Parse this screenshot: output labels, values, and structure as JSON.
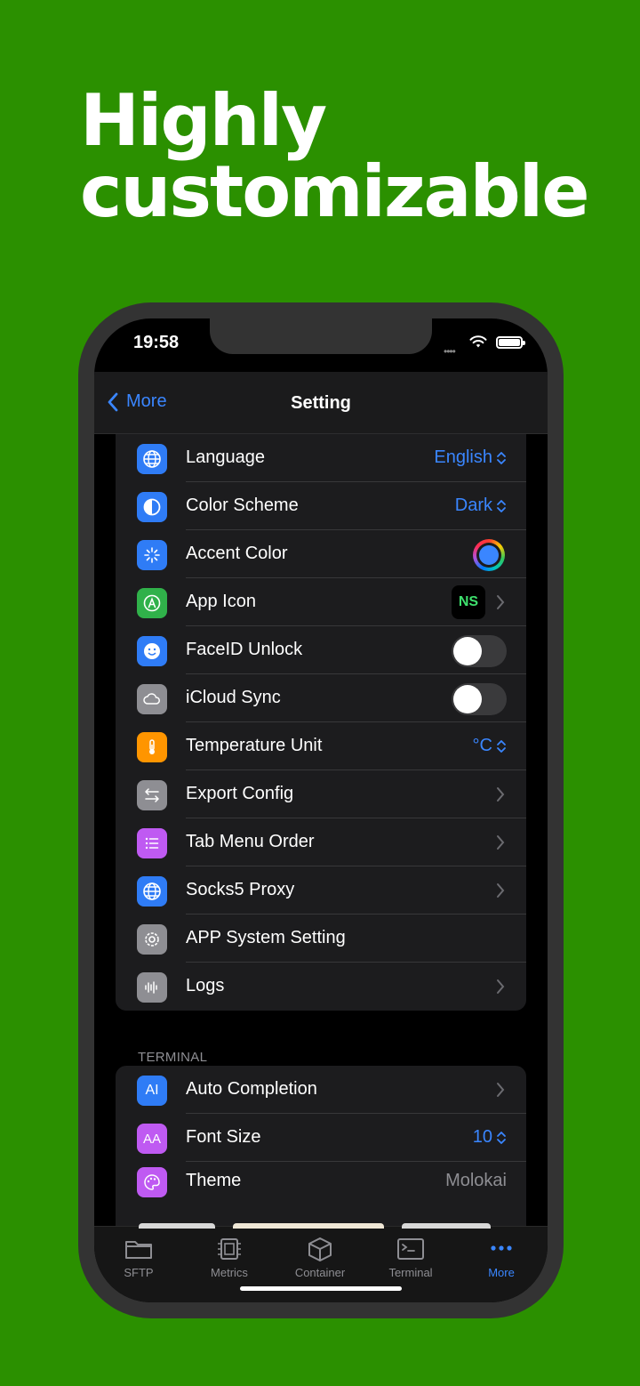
{
  "headline": {
    "line1": "Highly",
    "line2": "customizable"
  },
  "status": {
    "time": "19:58",
    "signal": "••••"
  },
  "nav": {
    "back_label": "More",
    "title": "Setting"
  },
  "settings": {
    "language": {
      "label": "Language",
      "value": "English",
      "icon": "globe-icon",
      "color": "#2f7cf6"
    },
    "color_scheme": {
      "label": "Color Scheme",
      "value": "Dark",
      "icon": "half-circle-icon",
      "color": "#2f7cf6"
    },
    "accent_color": {
      "label": "Accent Color",
      "icon": "sparkle-icon",
      "color": "#2f7cf6",
      "accent": "#3a86ff"
    },
    "app_icon": {
      "label": "App Icon",
      "icon": "app-store-icon",
      "color": "#30b14a",
      "preview": "NS"
    },
    "faceid": {
      "label": "FaceID Unlock",
      "icon": "face-icon",
      "color": "#2f7cf6",
      "on": false
    },
    "icloud": {
      "label": "iCloud Sync",
      "icon": "cloud-icon",
      "color": "#8e8e93",
      "on": false
    },
    "temperature": {
      "label": "Temperature Unit",
      "value": "°C",
      "icon": "thermometer-icon",
      "color": "#ff9500"
    },
    "export": {
      "label": "Export Config",
      "icon": "arrows-icon",
      "color": "#8e8e93"
    },
    "tab_order": {
      "label": "Tab Menu Order",
      "icon": "list-icon",
      "color": "#bf5af2"
    },
    "socks5": {
      "label": "Socks5 Proxy",
      "icon": "globe-icon",
      "color": "#2f7cf6"
    },
    "system": {
      "label": "APP System Setting",
      "icon": "gear-icon",
      "color": "#8e8e93"
    },
    "logs": {
      "label": "Logs",
      "icon": "waveform-icon",
      "color": "#8e8e93"
    }
  },
  "terminal": {
    "header": "TERMINAL",
    "auto_completion": {
      "label": "Auto Completion",
      "icon": "text-cursor-icon",
      "color": "#2f7cf6",
      "glyph": "AI"
    },
    "font_size": {
      "label": "Font Size",
      "value": "10",
      "icon": "font-size-icon",
      "color": "#bf5af2",
      "glyph": "AA"
    },
    "theme": {
      "label": "Theme",
      "value": "Molokai",
      "icon": "palette-icon",
      "color": "#bf5af2"
    }
  },
  "tabs": [
    {
      "label": "SFTP",
      "icon": "folder-icon"
    },
    {
      "label": "Metrics",
      "icon": "chip-icon"
    },
    {
      "label": "Container",
      "icon": "box-icon"
    },
    {
      "label": "Terminal",
      "icon": "terminal-icon"
    },
    {
      "label": "More",
      "icon": "more-icon",
      "active": true
    }
  ],
  "colors": {
    "background": "#2b9000",
    "accent": "#3a86ff"
  }
}
